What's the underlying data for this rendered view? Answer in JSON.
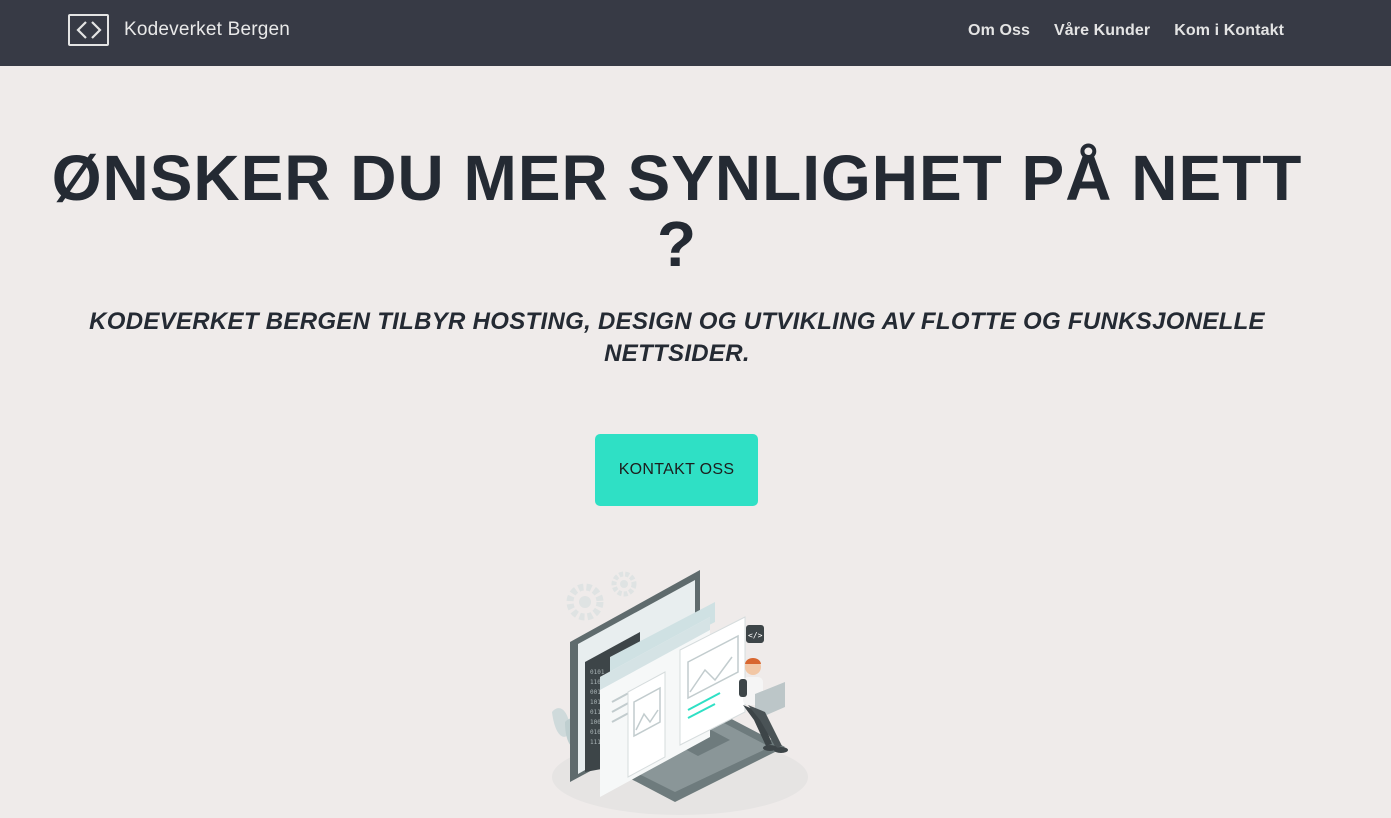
{
  "navbar": {
    "brand_icon": "code-brackets-icon",
    "brand_name": "Kodeverket Bergen",
    "links": [
      {
        "label": "Om Oss"
      },
      {
        "label": "Våre Kunder"
      },
      {
        "label": "Kom i Kontakt"
      }
    ]
  },
  "hero": {
    "title_line1": "ØNSKER DU MER SYNLIGHET PÅ NETT",
    "title_line2": "?",
    "subtitle": "KODEVERKET BERGEN TILBYR HOSTING, DESIGN OG UTVIKLING AV FLOTTE OG FUNKSJONELLE NETTSIDER.",
    "cta_label": "KONTAKT OSS",
    "illustration": "web-development-illustration"
  },
  "colors": {
    "navbar_bg": "#373a45",
    "page_bg": "#efebea",
    "accent": "#2fe0c5",
    "heading": "#242a33"
  }
}
